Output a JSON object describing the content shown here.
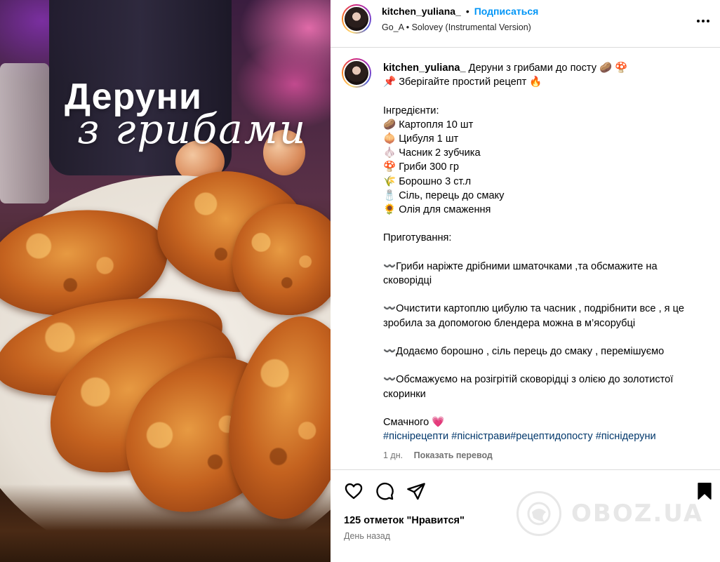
{
  "media": {
    "overlay_title": "Деруни",
    "overlay_subtitle": "з грибами"
  },
  "header": {
    "username": "kitchen_yuliana_",
    "separator": "•",
    "follow_label": "Подписаться",
    "audio_label": "Go_A • Solovey (Instrumental Version)",
    "more_icon": "more-horizontal-icon"
  },
  "caption": {
    "username": "kitchen_yuliana_",
    "text": " Деруни з грибами до посту 🥔 🍄\n📌 Зберігайте простий рецепт 🔥\n\nІнгредієнти:\n🥔 Картопля 10 шт\n🧅 Цибуля 1 шт\n🧄 Часник 2 зубчика\n🍄 Гриби 300 гр\n🌾 Борошно 3 ст.л\n🧂 Сіль, перець до смаку\n🌻 Олія для смаження\n\nПриготування:\n\n〰️Гриби наріжте дрібними шматочками ,та обсмажите на сковорідці\n\n〰️Очистити картоплю цибулю та часник , подрібнити все , я це зробила за допомогою блендера можна в м’ясорубці\n\n〰️Додаємо борошно , сіль перець до смаку , перемішуємо\n\n〰️Обсмажуємо на розігрітій сковорідці з олією до золотистої скоринки\n\nСмачного 💗\n",
    "hashtags": "#піснірецепти #пісністрави#рецептидопосту #піснідеруни",
    "age": "1 дн.",
    "translate_label": "Показать перевод"
  },
  "actions": {
    "likes": "125 отметок \"Нравится\"",
    "time_ago": "День назад",
    "icons": [
      "heart-icon",
      "comment-icon",
      "share-icon",
      "bookmark-icon"
    ]
  },
  "watermark": {
    "text": "OBOZ.UA"
  },
  "colors": {
    "follow_blue": "#0095f6",
    "hashtag_blue": "#00376b",
    "muted_gray": "#737373",
    "divider": "#dbdbdb"
  }
}
